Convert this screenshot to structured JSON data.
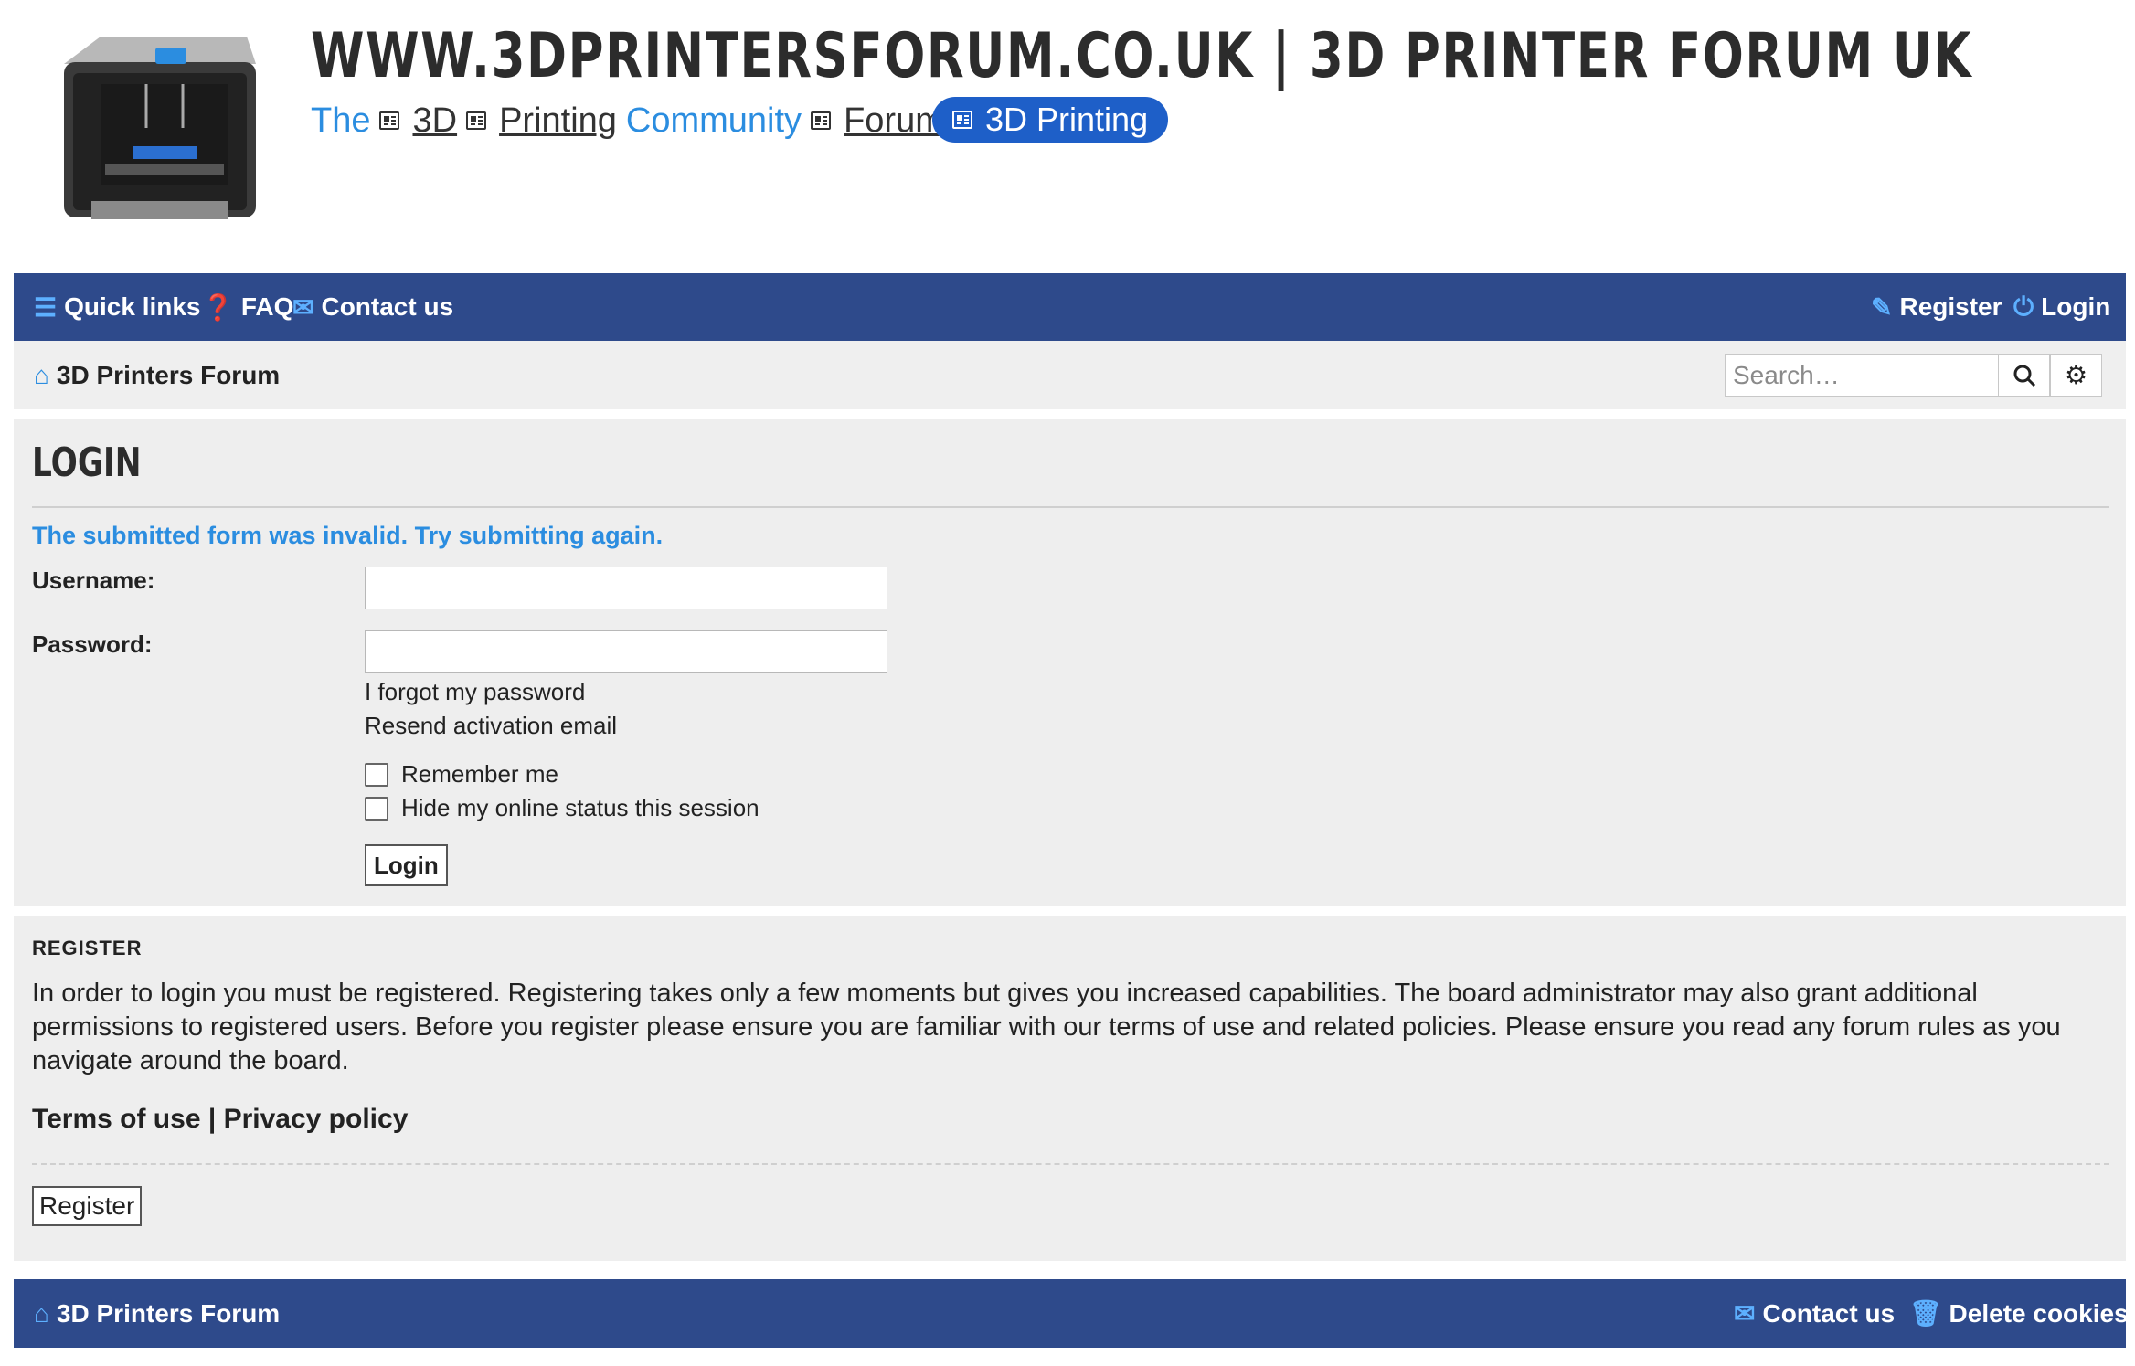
{
  "header": {
    "site_title": "WWW.3DPRINTERSFORUM.CO.UK | 3D PRINTER FORUM UK",
    "tagline": [
      "The",
      "3D",
      "Printing",
      "Community",
      "Forum"
    ],
    "tag_pill": "3D Printing",
    "logo_icon": "3d-printer-logo"
  },
  "navbar": {
    "quick_links": "Quick links",
    "faq": "FAQ",
    "contact": "Contact us",
    "register": "Register",
    "login": "Login"
  },
  "breadcrumb": {
    "home": "3D Printers Forum"
  },
  "search": {
    "placeholder": "Search…"
  },
  "login": {
    "title": "LOGIN",
    "error": "The submitted form was invalid. Try submitting again.",
    "username_label": "Username:",
    "password_label": "Password:",
    "forgot": "I forgot my password",
    "resend": "Resend activation email",
    "remember": "Remember me",
    "hide_status": "Hide my online status this session",
    "button": "Login"
  },
  "register": {
    "heading": "REGISTER",
    "text": "In order to login you must be registered. Registering takes only a few moments but gives you increased capabilities. The board administrator may also grant additional permissions to registered users. Before you register please ensure you are familiar with our terms of use and related policies. Please ensure you read any forum rules as you navigate around the board.",
    "terms": "Terms of use",
    "separator": "|",
    "privacy": "Privacy policy",
    "button": "Register"
  },
  "footer": {
    "home": "3D Printers Forum",
    "contact": "Contact us",
    "delete_cookies": "Delete cookies"
  },
  "colors": {
    "nav_bg": "#2e4a8b",
    "accent": "#2b8de0",
    "pill": "#1e5fc8",
    "panel_bg": "#eeeeee"
  }
}
